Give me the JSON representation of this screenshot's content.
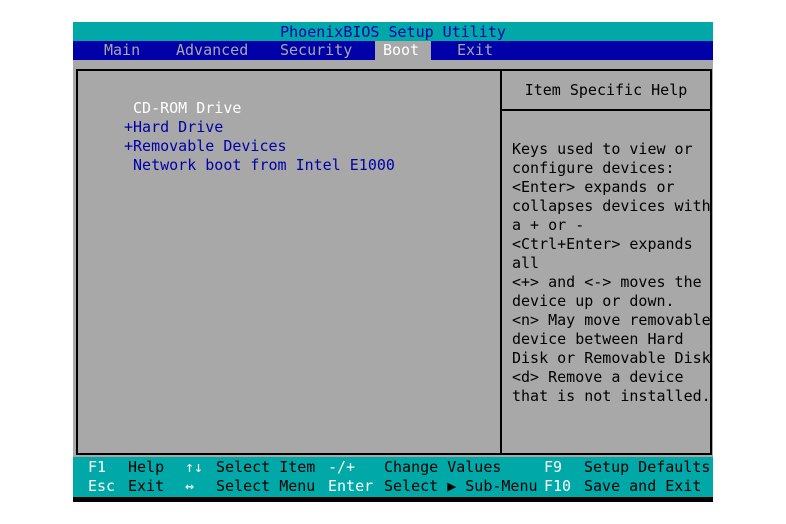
{
  "title": "PhoenixBIOS Setup Utility",
  "menu": [
    "Main",
    "Advanced",
    "Security",
    "Boot",
    "Exit"
  ],
  "active_menu": "Boot",
  "boot_items": [
    {
      "prefix": " ",
      "label": "CD-ROM Drive",
      "selected": true
    },
    {
      "prefix": "+",
      "label": "Hard Drive",
      "selected": false
    },
    {
      "prefix": "+",
      "label": "Removable Devices",
      "selected": false
    },
    {
      "prefix": " ",
      "label": "Network boot from Intel E1000",
      "selected": false
    }
  ],
  "help": {
    "title": "Item Specific Help",
    "lines": [
      "Keys used to view or",
      "configure devices:",
      "<Enter> expands or",
      "collapses devices with",
      "a + or -",
      "<Ctrl+Enter> expands",
      "all",
      "<+> and <-> moves the",
      "device up or down.",
      "<n> May move removable",
      "device between Hard",
      "Disk or Removable Disk",
      "<d> Remove a device",
      "that is not installed."
    ]
  },
  "footer": {
    "row1": [
      {
        "key": "F1",
        "desc": "Help"
      },
      {
        "key": "↑↓",
        "desc": "Select Item"
      },
      {
        "key": "-/+",
        "desc": "Change Values"
      },
      {
        "key": "F9",
        "desc": "Setup Defaults"
      }
    ],
    "row2": [
      {
        "key": "Esc",
        "desc": "Exit"
      },
      {
        "key": "↔",
        "desc": "Select Menu"
      },
      {
        "key": "Enter",
        "desc": "Select ▶ Sub-Menu"
      },
      {
        "key": "F10",
        "desc": "Save and Exit"
      }
    ]
  },
  "colors": {
    "cyan": "#00a8a8",
    "blue": "#0000a8",
    "gray": "#a8a8a8",
    "white": "#ffffff",
    "black": "#000000"
  }
}
